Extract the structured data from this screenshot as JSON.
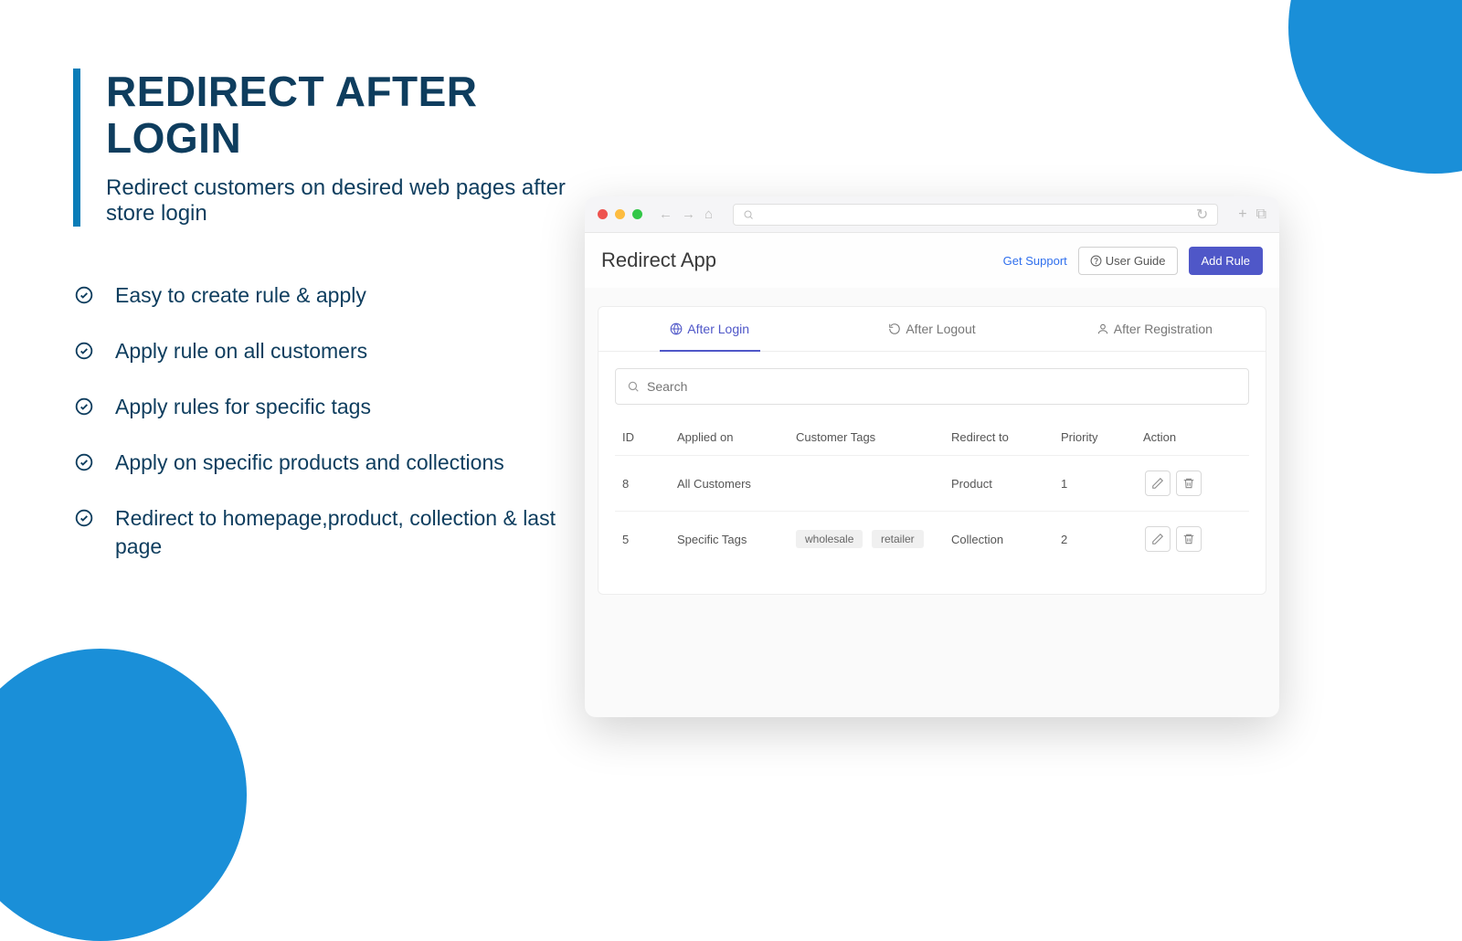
{
  "hero": {
    "title": "REDIRECT AFTER LOGIN",
    "subtitle": "Redirect customers on desired web pages after store login"
  },
  "features": [
    "Easy to create rule & apply",
    "Apply rule on all customers",
    "Apply rules for specific tags",
    "Apply on specific products and collections",
    "Redirect to homepage,product, collection & last page"
  ],
  "app": {
    "title": "Redirect App",
    "support_label": "Get Support",
    "guide_label": "User Guide",
    "add_rule_label": "Add Rule"
  },
  "tabs": [
    {
      "label": "After Login",
      "active": true
    },
    {
      "label": "After Logout",
      "active": false
    },
    {
      "label": "After Registration",
      "active": false
    }
  ],
  "search": {
    "placeholder": "Search"
  },
  "columns": {
    "id": "ID",
    "applied_on": "Applied on",
    "customer_tags": "Customer Tags",
    "redirect_to": "Redirect to",
    "priority": "Priority",
    "action": "Action"
  },
  "rows": [
    {
      "id": "8",
      "applied_on": "All Customers",
      "tags": [],
      "redirect_to": "Product",
      "priority": "1"
    },
    {
      "id": "5",
      "applied_on": "Specific Tags",
      "tags": [
        "wholesale",
        "retailer"
      ],
      "redirect_to": "Collection",
      "priority": "2"
    }
  ]
}
